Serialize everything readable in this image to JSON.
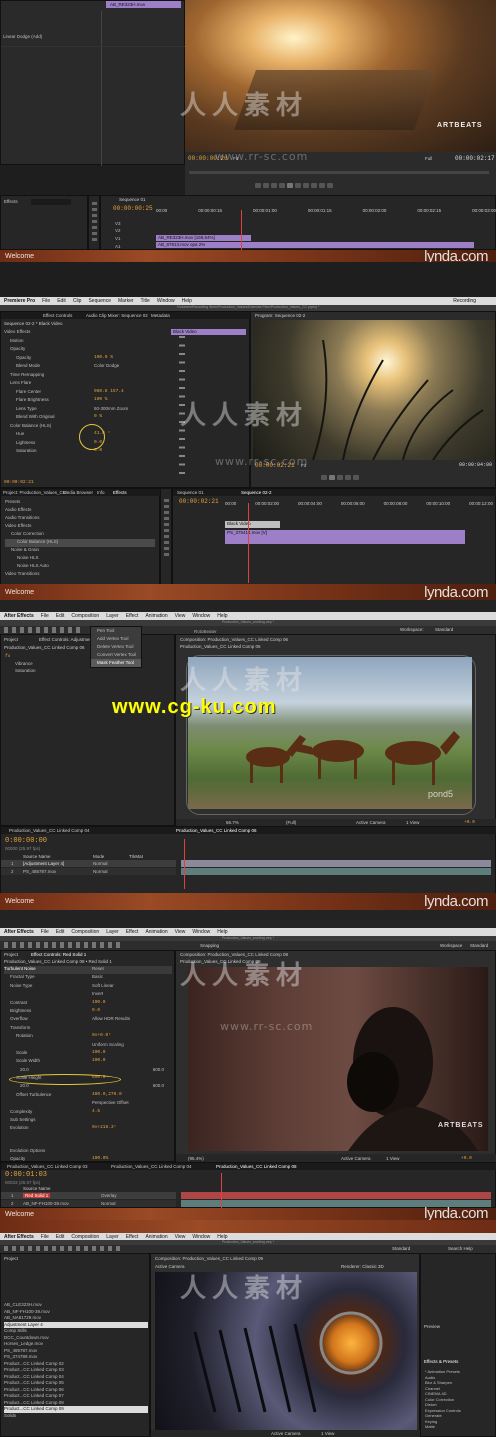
{
  "frame1": {
    "clip_name": "AB_RE323H.mov",
    "blend_label": "Linear Dodge (Add)",
    "monitor_timecode_left": "00:00:00:26",
    "monitor_timecode_right": "00:00:02:17",
    "fit_label": "Fit",
    "full_label": "Full",
    "effects_tab": "Effects",
    "sequence_tab": "Sequence 01",
    "sequence_timecode": "00:00:00:25",
    "ruler": [
      "00:00",
      "00:00:00:15",
      "00:00:01:00",
      "00:00:01:15",
      "00:00:02:00",
      "00:00:02:15",
      "00:00:03:00"
    ],
    "tracks": [
      "V3",
      "V2",
      "V1",
      "A1"
    ],
    "clip_v2": "AB_RE323H.mov [159,54%]",
    "clip_v1": "AB_87813.mov opa 2%",
    "welcome": "Welcome",
    "brand": "lynda.com",
    "art_credit": "ARTBEATS"
  },
  "frame2": {
    "app_name": "Premiere Pro",
    "menu": [
      "File",
      "Edit",
      "Clip",
      "Sequence",
      "Marker",
      "Title",
      "Window",
      "Help"
    ],
    "window_title": "/Volumes/Recording Work/Production_Values/Exercise Files/Production_Values_CC.prproj *",
    "recording_label": "Recording",
    "tab_effect_controls": "Effect Controls",
    "tab_audio_mixer": "Audio Clip Mixer: Sequence 02",
    "tab_metadata": "Metadata",
    "ec_header": "Sequence 02-2 * Black Video",
    "ec_clip": "Black Video",
    "ec_rows": [
      {
        "label": "Video Effects",
        "value": ""
      },
      {
        "label": "Motion",
        "value": ""
      },
      {
        "label": "Opacity",
        "value": ""
      },
      {
        "label": "Opacity",
        "value": "100.0 %"
      },
      {
        "label": "Blend Mode",
        "value": "Color Dodge"
      },
      {
        "label": "Time Remapping",
        "value": ""
      },
      {
        "label": "Lens Flare",
        "value": ""
      },
      {
        "label": "Flare Center",
        "value": "960.8   157.4"
      },
      {
        "label": "Flare Brightness",
        "value": "100 %"
      },
      {
        "label": "Lens Type",
        "value": "50-300mm Zoom"
      },
      {
        "label": "Blend With Original",
        "value": "0 %"
      },
      {
        "label": "Color Balance (HLS)",
        "value": ""
      },
      {
        "label": "Hue",
        "value": "41.0 °"
      },
      {
        "label": "Lightness",
        "value": "0.0"
      },
      {
        "label": "Saturation",
        "value": "0.0"
      }
    ],
    "ec_timecode": "00:00:02:21",
    "program_tab": "Program: Sequence 02-2",
    "program_timecode": "00:00:02:21",
    "program_fit": "Fit",
    "program_right": "00:00:04:00",
    "project_tab": "Project: Production_Values_CC",
    "media_browser_tab": "Media Browser",
    "info_tab": "Info",
    "effects_tab": "Effects",
    "effects_list": [
      "Presets",
      "Audio Effects",
      "Audio Transitions",
      "Video Effects",
      "Color Correction",
      "Color Balance (HLS)",
      "Noise & Grain",
      "Noise HLS",
      "Noise HLS Auto",
      "Video Transitions"
    ],
    "seq_tab1": "Sequence 01",
    "seq_tab2": "Sequence 02-2",
    "seq_timecode": "00:00:02:21",
    "seq_ruler": [
      "00:00",
      "00:00:02:00",
      "00:00:04:00",
      "00:00:06:00",
      "00:00:08:00",
      "00:00:10:00",
      "00:00:12:00"
    ],
    "clip_black": "Black Video",
    "clip_ps": "PS_375414.mov [V]",
    "welcome": "Welcome",
    "brand": "lynda.com"
  },
  "frame3": {
    "app_name": "After Effects",
    "menu": [
      "File",
      "Edit",
      "Composition",
      "Layer",
      "Effect",
      "Animation",
      "View",
      "Window",
      "Help"
    ],
    "window_title": "Production_Values_working.aep *",
    "workspace_label": "Workspace:",
    "workspace_value": "Standard",
    "dropdown_items": [
      "Pen Tool",
      "Add Vertex Tool",
      "Delete Vertex Tool",
      "Convert Vertex Tool",
      "Mask Feather Tool"
    ],
    "project_tab": "Project",
    "ec_tab": "Effect Controls: Adjustment",
    "ec_header": "Production_Values_CC Linked Comp 06",
    "ec_rows": [
      "Vibrance",
      "Saturation"
    ],
    "fx_label": "fx",
    "comp_tab": "Composition: Production_Values_CC Linked Comp 06",
    "comp_sub": "Production_Values_CC Linked Comp 06",
    "rotobrush": "RotoBeater",
    "overlay_url": "www.cg-ku.com",
    "pond_label": "pond5",
    "zoom_label": "66.7%",
    "view_full": "(Full)",
    "active_camera": "Active Camera",
    "view_count": "1 View",
    "offset": "+0.0",
    "timeline_tab1": "Production_Values_CC Linked Comp 04",
    "timeline_tab2": "Production_Values_CC Linked Comp 06",
    "timecode": "0:00:00:00",
    "fps": "00000 (25.97 fps)",
    "col_source": "Source Name",
    "col_mode": "Mode",
    "col_trkmat": "TrkMat",
    "layers": [
      {
        "num": "1",
        "name": "[Adjustment Layer 4]",
        "mode": "Normal"
      },
      {
        "num": "2",
        "name": "PS_485787.mov",
        "mode": "Normal"
      }
    ],
    "welcome": "Welcome",
    "brand": "lynda.com"
  },
  "frame4": {
    "app_name": "After Effects",
    "menu": [
      "File",
      "Edit",
      "Composition",
      "Layer",
      "Effect",
      "Animation",
      "View",
      "Window",
      "Help"
    ],
    "window_title": "Production_Values_working.aep *",
    "snapping": "Snapping",
    "workspace_label": "Workspace",
    "workspace_value": "Standard",
    "project_tab": "Project",
    "ec_tab": "Effect Controls: Red Solid 1",
    "ec_header": "Production_Values_CC Linked Comp 08 • Red Solid 1",
    "ec_rows": [
      {
        "label": "Turbulent Noise",
        "value": "Reset"
      },
      {
        "label": "Fractal Type",
        "value": "Basic"
      },
      {
        "label": "Noise Type",
        "value": "Soft Linear"
      },
      {
        "label": "",
        "value": "Invert"
      },
      {
        "label": "Contrast",
        "value": "100.0"
      },
      {
        "label": "Brightness",
        "value": "0.0"
      },
      {
        "label": "Overflow",
        "value": "Allow HDR Results"
      },
      {
        "label": "Transform",
        "value": ""
      },
      {
        "label": "Rotation",
        "value": "0x+0.0°"
      },
      {
        "label": "",
        "value": "Uniform Scaling"
      },
      {
        "label": "Scale",
        "value": "100.0"
      },
      {
        "label": "Scale Width",
        "value": "100.0"
      },
      {
        "label": "20.0",
        "value": "600.0"
      },
      {
        "label": "Scale Height",
        "value": "600.0"
      },
      {
        "label": "20.0",
        "value": "600.0"
      },
      {
        "label": "Offset Turbulence",
        "value": "480.0,270.0"
      },
      {
        "label": "",
        "value": "Perspective Offset"
      },
      {
        "label": "Complexity",
        "value": "4.5"
      },
      {
        "label": "Sub Settings",
        "value": ""
      },
      {
        "label": "Evolution",
        "value": "0x+218.3°"
      },
      {
        "label": "Evolution Options",
        "value": ""
      },
      {
        "label": "Opacity",
        "value": "100.0%"
      },
      {
        "label": "Blending Mode",
        "value": "Normal"
      }
    ],
    "comp_tab": "Composition: Production_Values_CC Linked Comp 08",
    "comp_sub": "Production_Values_CC Linked Comp 08",
    "art_credit": "ARTBEATS",
    "zoom_label": "(95.4%)",
    "active_camera": "Active Camera",
    "view_count": "1 View",
    "offset": "+0.0",
    "timeline_tabs": [
      "Production_Values_CC Linked Comp 03",
      "Production_Values_CC Linked Comp 04",
      "Production_Values_CC Linked Comp 08"
    ],
    "timecode": "0:00:01:03",
    "fps": "00033 (25.97 fps)",
    "col_source": "Source Name",
    "layers": [
      {
        "num": "1",
        "name": "Red Solid 1",
        "mode": "Overlay"
      },
      {
        "num": "2",
        "name": "AB_NF-FH100-39.mov",
        "mode": "Normal"
      }
    ],
    "welcome": "Welcome",
    "brand": "lynda.com"
  },
  "frame5": {
    "app_name": "After Effects",
    "menu": [
      "File",
      "Edit",
      "Composition",
      "Layer",
      "Effect",
      "Animation",
      "View",
      "Window",
      "Help"
    ],
    "window_title": "Production_Values_working.aep *",
    "search_help": "Search Help",
    "workspace_value": "Standard",
    "project_tab": "Project",
    "project_items": [
      "AB_CLE323H.mov",
      "AB_NF-FH100-39.mov",
      "AB_NA81729.mov",
      "Adjustment Layer 4",
      "Comp Stills",
      "DCC_Countdown.mov",
      "Horses_Ledge.mov",
      "PS_485787.mov",
      "PS_374789.mov",
      "Product...CC Linked Comp 02",
      "Product...CC Linked Comp 03",
      "Product...CC Linked Comp 04",
      "Product...CC Linked Comp 05",
      "Product...CC Linked Comp 06",
      "Product...CC Linked Comp 07",
      "Product...CC Linked Comp 08",
      "Product...CC Linked Comp 09",
      "Solids"
    ],
    "comp_tab": "Composition: Production_Values_CC Linked Comp 09",
    "active_camera": "Active Camera",
    "renderer": "Renderer: Classic 3D",
    "view_count": "1 View",
    "preview_tab": "Preview",
    "effects_tab": "Effects & Presets",
    "effects_list": [
      "* Animation Presets",
      "Audio",
      "Blur & Sharpen",
      "Channel",
      "CINEMA 4D",
      "Color Correction",
      "Distort",
      "Expression Controls",
      "Generate",
      "Keying",
      "Matte"
    ],
    "welcome": "Welcome",
    "brand": "lynda.com"
  },
  "watermark": {
    "cn_text": "人人素材",
    "url_text": "www.rr-sc.com"
  },
  "colors": {
    "timecode": "#e8a33a",
    "clip_purple": "#9d7fc7",
    "welcome_bar": "#7b3519",
    "overlay_url": "#ffff00",
    "scale_circle": "#e8c83a"
  }
}
